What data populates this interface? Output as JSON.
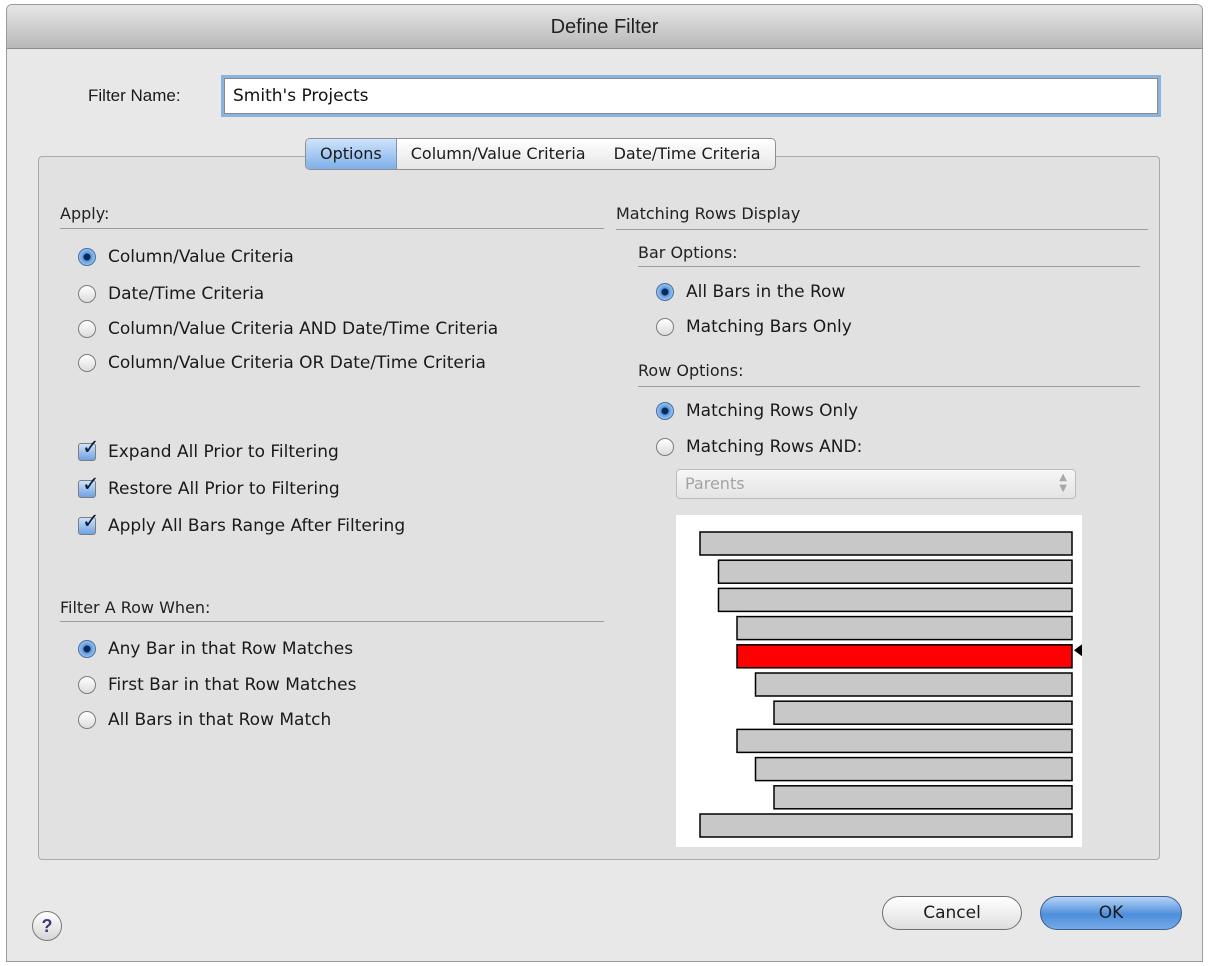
{
  "window": {
    "title": "Define Filter"
  },
  "filter_name": {
    "label": "Filter Name:",
    "value": "Smith's Projects"
  },
  "tabs": [
    {
      "label": "Options",
      "active": true
    },
    {
      "label": "Column/Value Criteria",
      "active": false
    },
    {
      "label": "Date/Time Criteria",
      "active": false
    }
  ],
  "apply": {
    "heading": "Apply:",
    "options": [
      {
        "label": "Column/Value Criteria",
        "selected": true
      },
      {
        "label": "Date/Time Criteria",
        "selected": false
      },
      {
        "label": "Column/Value Criteria AND Date/Time Criteria",
        "selected": false
      },
      {
        "label": "Column/Value Criteria OR Date/Time Criteria",
        "selected": false
      }
    ]
  },
  "checkboxes": [
    {
      "label": "Expand All Prior to Filtering",
      "checked": true
    },
    {
      "label": "Restore All Prior to Filtering",
      "checked": true
    },
    {
      "label": "Apply All Bars Range After Filtering",
      "checked": true
    }
  ],
  "filter_row": {
    "heading": "Filter A Row When:",
    "options": [
      {
        "label": "Any Bar in that Row Matches",
        "selected": true
      },
      {
        "label": "First Bar in that Row Matches",
        "selected": false
      },
      {
        "label": "All Bars in that Row Match",
        "selected": false
      }
    ]
  },
  "matching_display": {
    "heading": "Matching Rows Display",
    "bar_options": {
      "heading": "Bar Options:",
      "options": [
        {
          "label": "All Bars in the Row",
          "selected": true
        },
        {
          "label": "Matching Bars Only",
          "selected": false
        }
      ]
    },
    "row_options": {
      "heading": "Row Options:",
      "options": [
        {
          "label": "Matching Rows Only",
          "selected": true
        },
        {
          "label": "Matching Rows AND:",
          "selected": false
        }
      ],
      "select_value": "Parents",
      "select_enabled": false
    }
  },
  "preview_bars": [
    {
      "indent": 0,
      "highlighted": false
    },
    {
      "indent": 1,
      "highlighted": false
    },
    {
      "indent": 1,
      "highlighted": false
    },
    {
      "indent": 2,
      "highlighted": false
    },
    {
      "indent": 2,
      "highlighted": true
    },
    {
      "indent": 3,
      "highlighted": false
    },
    {
      "indent": 4,
      "highlighted": false
    },
    {
      "indent": 2,
      "highlighted": false
    },
    {
      "indent": 3,
      "highlighted": false
    },
    {
      "indent": 4,
      "highlighted": false
    },
    {
      "indent": 0,
      "highlighted": false
    }
  ],
  "colors": {
    "bar_fill": "#c8c8c8",
    "bar_highlight": "#ff0000",
    "accent": "#6fa2e2"
  },
  "buttons": {
    "help": "?",
    "cancel": "Cancel",
    "ok": "OK"
  }
}
